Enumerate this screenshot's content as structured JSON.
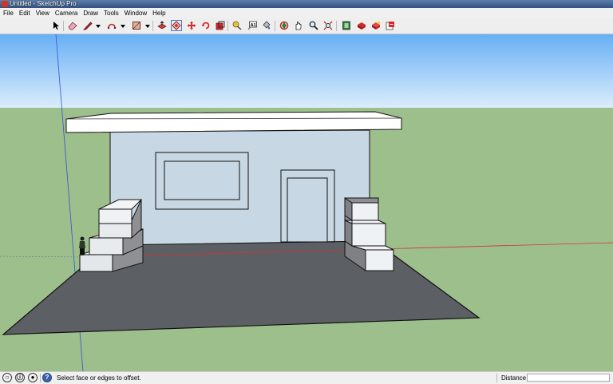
{
  "window": {
    "title": "Untitled - SketchUp Pro"
  },
  "menu": [
    "File",
    "Edit",
    "View",
    "Camera",
    "Draw",
    "Tools",
    "Window",
    "Help"
  ],
  "toolbar": {
    "tools": [
      "select-tool",
      "eraser-tool",
      "pencil-tool",
      "arc-tool",
      "rectangle-tool",
      "push-pull-tool",
      "offset-tool",
      "move-tool",
      "rotate-tool",
      "scale-tool",
      "tape-measure-tool",
      "text-tool",
      "paint-bucket-tool",
      "orbit-tool",
      "pan-tool",
      "zoom-tool",
      "zoom-extents-tool",
      "components-tool",
      "warehouse-tool",
      "extension-warehouse-tool",
      "send-to-layout-tool"
    ],
    "active_tool": "offset-tool"
  },
  "statusbar": {
    "hint": "Select face or edges to offset.",
    "measurement_label": "Distance",
    "measurement_value": ""
  },
  "colors": {
    "sky_top": "#67aff4",
    "sky_bottom": "#dbedfd",
    "ground": "#9dbf8c",
    "floor": "#5c5f64",
    "wall": "#c7d7e3",
    "roof": "#ffffff",
    "step_top": "#f2f4f6",
    "step_side": "#8e9094",
    "red_axis": "#d83232",
    "blue_axis": "#3a4fd6"
  }
}
